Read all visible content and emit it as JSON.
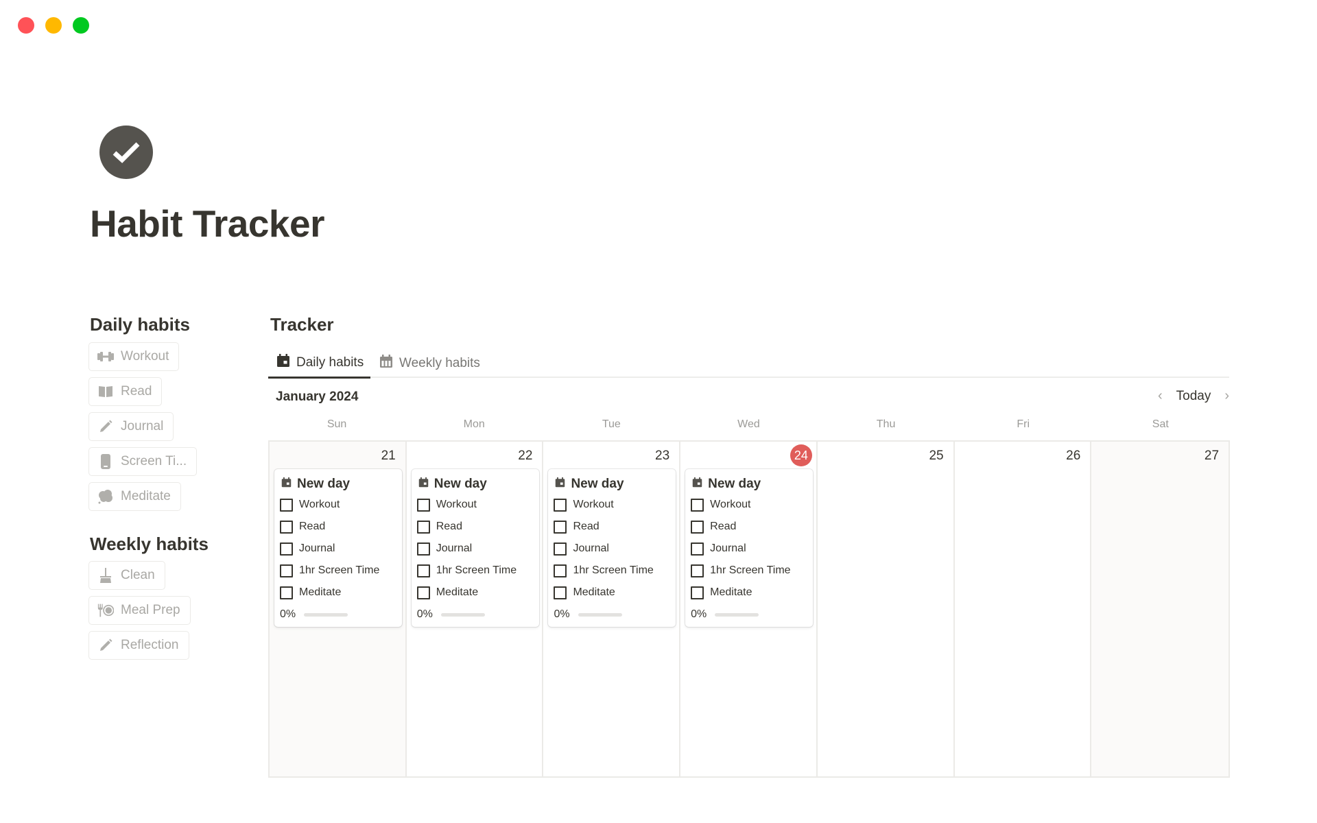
{
  "window": {
    "controls": [
      {
        "name": "close",
        "color": "#ff5257"
      },
      {
        "name": "minimize",
        "color": "#ffb800"
      },
      {
        "name": "zoom",
        "color": "#00c920"
      }
    ]
  },
  "page": {
    "icon": "check-circle-icon",
    "title": "Habit Tracker"
  },
  "sidebar": {
    "daily_heading": "Daily habits",
    "daily_items": [
      {
        "label": "Workout",
        "icon": "dumbbell-icon"
      },
      {
        "label": "Read",
        "icon": "book-icon"
      },
      {
        "label": "Journal",
        "icon": "pencil-icon"
      },
      {
        "label": "Screen Ti...",
        "icon": "phone-icon"
      },
      {
        "label": "Meditate",
        "icon": "cloud-icon"
      }
    ],
    "weekly_heading": "Weekly habits",
    "weekly_items": [
      {
        "label": "Clean",
        "icon": "broom-icon"
      },
      {
        "label": "Meal Prep",
        "icon": "plate-icon"
      },
      {
        "label": "Reflection",
        "icon": "pencil-icon"
      }
    ]
  },
  "tracker": {
    "title": "Tracker",
    "tabs": [
      {
        "label": "Daily habits",
        "icon": "calendar-icon",
        "active": true
      },
      {
        "label": "Weekly habits",
        "icon": "calendar-grid-icon",
        "active": false
      }
    ],
    "month_label": "January 2024",
    "today_label": "Today",
    "weekdays": [
      "Sun",
      "Mon",
      "Tue",
      "Wed",
      "Thu",
      "Fri",
      "Sat"
    ],
    "days": [
      {
        "num": "21",
        "today": false,
        "weekend": true,
        "has_card": true
      },
      {
        "num": "22",
        "today": false,
        "weekend": false,
        "has_card": true
      },
      {
        "num": "23",
        "today": false,
        "weekend": false,
        "has_card": true
      },
      {
        "num": "24",
        "today": true,
        "weekend": false,
        "has_card": true
      },
      {
        "num": "25",
        "today": false,
        "weekend": false,
        "has_card": false
      },
      {
        "num": "26",
        "today": false,
        "weekend": false,
        "has_card": false
      },
      {
        "num": "27",
        "today": false,
        "weekend": true,
        "has_card": false
      }
    ],
    "card": {
      "title": "New day",
      "habits": [
        {
          "label": "Workout",
          "checked": false
        },
        {
          "label": "Read",
          "checked": false
        },
        {
          "label": "Journal",
          "checked": false
        },
        {
          "label": "1hr Screen Time",
          "checked": false
        },
        {
          "label": "Meditate",
          "checked": false
        }
      ],
      "progress_label": "0%",
      "progress_value": 0
    },
    "today_color": "#e05d5a"
  }
}
